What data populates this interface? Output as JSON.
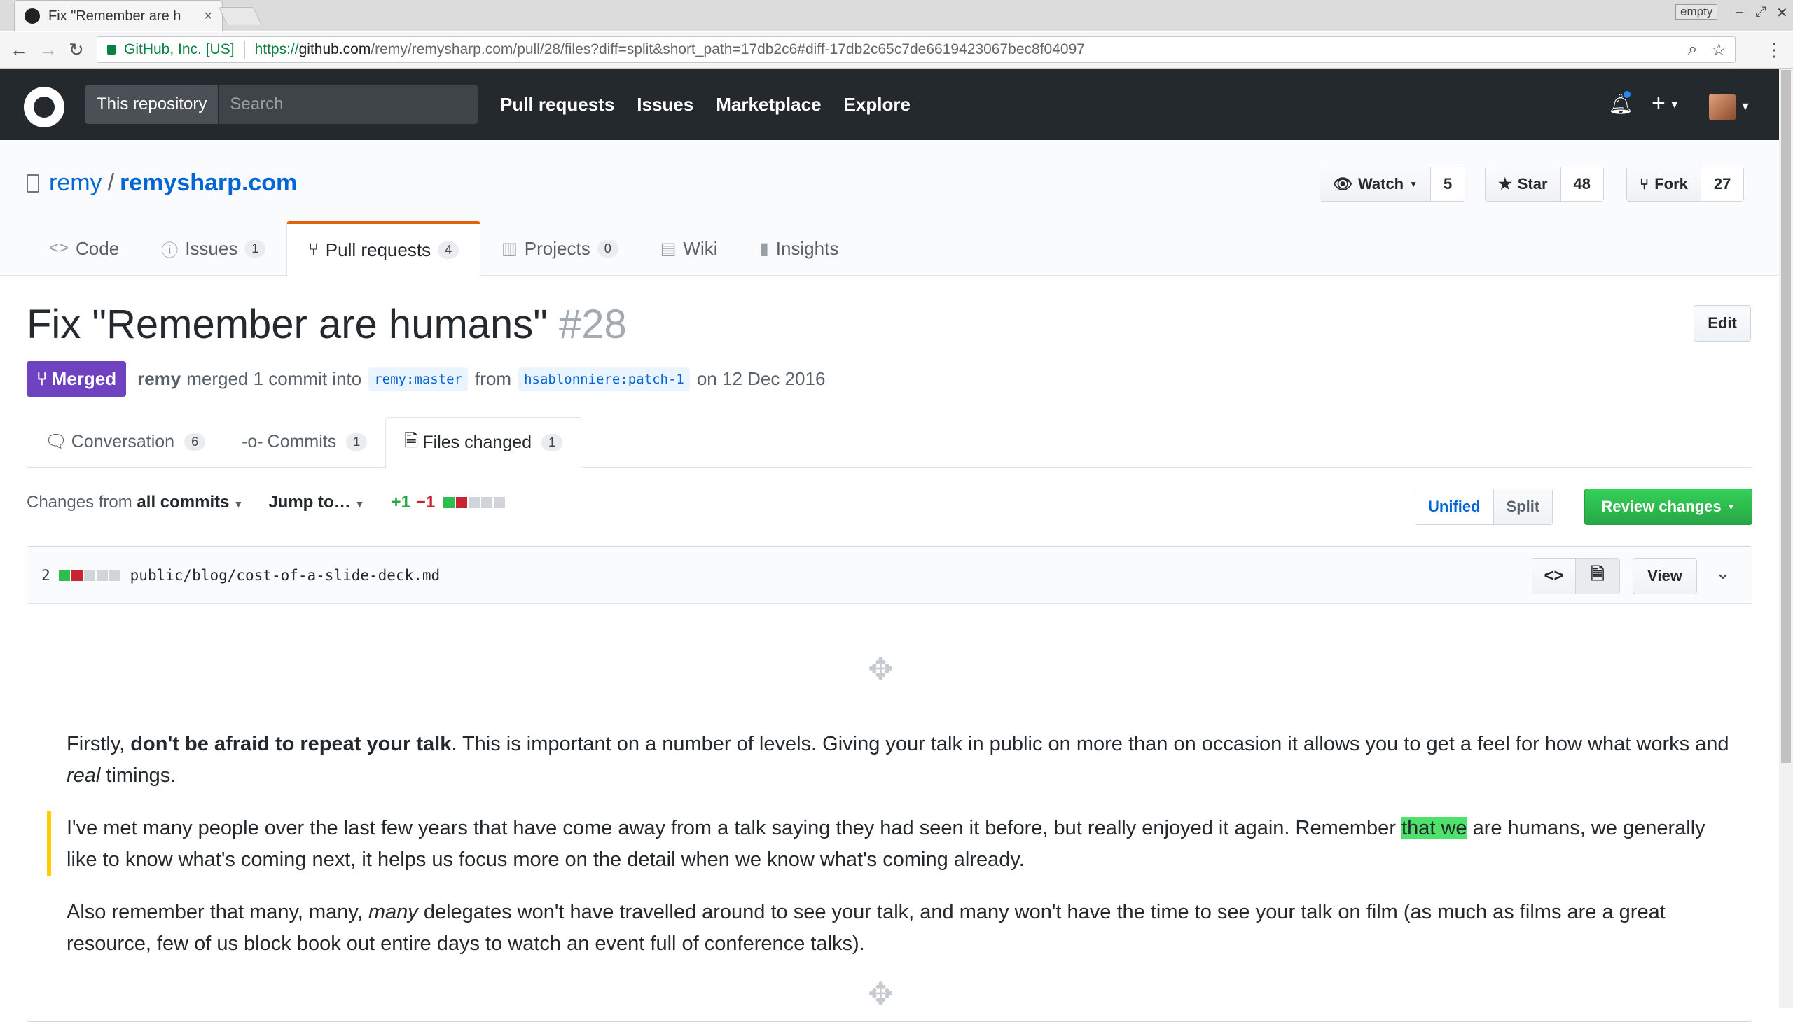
{
  "browser": {
    "tab_title": "Fix \"Remember are h",
    "tab_close": "×",
    "profile_badge": "empty",
    "url_secure_label": "GitHub, Inc. [US]",
    "url_scheme": "https://",
    "url_host": "github.com",
    "url_path": "/remy/remysharp.com/pull/28/files?diff=split&short_path=17db2c6#diff-17db2c65c7de6619423067bec8f04097"
  },
  "header": {
    "scope_label": "This repository",
    "search_placeholder": "Search",
    "nav": [
      "Pull requests",
      "Issues",
      "Marketplace",
      "Explore"
    ],
    "new_label": "+"
  },
  "repo": {
    "owner": "remy",
    "separator": "/",
    "name": "remysharp.com",
    "watch_label": "Watch",
    "watch_count": "5",
    "star_label": "Star",
    "star_count": "48",
    "fork_label": "Fork",
    "fork_count": "27",
    "tabs": [
      {
        "label": "Code",
        "count": ""
      },
      {
        "label": "Issues",
        "count": "1"
      },
      {
        "label": "Pull requests",
        "count": "4"
      },
      {
        "label": "Projects",
        "count": "0"
      },
      {
        "label": "Wiki",
        "count": ""
      },
      {
        "label": "Insights",
        "count": ""
      }
    ]
  },
  "pr": {
    "title": "Fix \"Remember are humans\"",
    "number": "#28",
    "edit_label": "Edit",
    "state": "Merged",
    "author": "remy",
    "merge_text": "merged 1 commit into",
    "base_branch": "remy:master",
    "from_text": "from",
    "head_branch": "hsablonniere:patch-1",
    "date_text": "on 12 Dec 2016",
    "tabs": [
      {
        "label": "Conversation",
        "count": "6"
      },
      {
        "label": "Commits",
        "count": "1"
      },
      {
        "label": "Files changed",
        "count": "1"
      }
    ]
  },
  "toolbar": {
    "changes_from": "Changes from",
    "all_commits": "all commits",
    "jump_to": "Jump to…",
    "additions": "+1",
    "deletions": "−1",
    "unified": "Unified",
    "split": "Split",
    "review_changes": "Review changes"
  },
  "file": {
    "change_count": "2",
    "path": "public/blog/cost-of-a-slide-deck.md",
    "view_label": "View",
    "p1": {
      "a": "Firstly, ",
      "b": "don't be afraid to repeat your talk",
      "c": ". This is important on a number of levels. Giving your talk in public on more than on occasion it allows you to get a feel for how what works and ",
      "d": "real",
      "e": " timings."
    },
    "p2": {
      "a": "I've met many people over the last few years that have come away from a talk saying they had seen it before, but really enjoyed it again. Remember ",
      "highlight": "that we",
      "b": " are humans, we generally like to know what's coming next, it helps us focus more on the detail when we know what's coming already."
    },
    "p3": {
      "a": "Also remember that many, many, ",
      "b": "many",
      "c": " delegates won't have travelled around to see your talk, and many won't have the time to see your talk on film (as much as films are a great resource, few of us block book out entire days to watch an event full of conference talks)."
    }
  }
}
